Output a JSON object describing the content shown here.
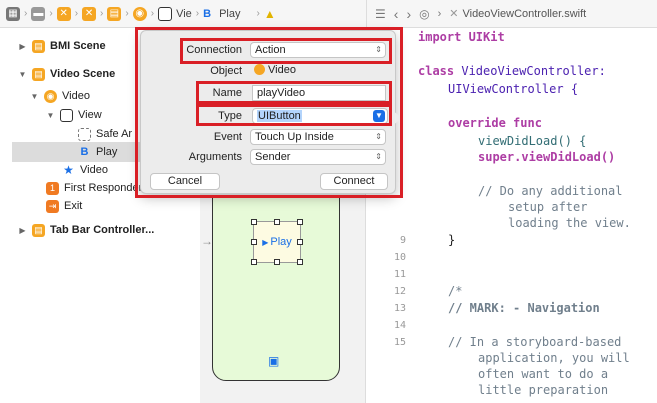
{
  "breadcrumb": {
    "view": "Vie",
    "play": "Play"
  },
  "editor": {
    "filename": "VideoViewController.swift"
  },
  "outline": {
    "bmi_scene": "BMI Scene",
    "video_scene": "Video Scene",
    "video_controller": "Video",
    "view": "View",
    "safe_area": "Safe Ar",
    "play": "Play",
    "video_item": "Video",
    "first_responder": "First Responder",
    "exit": "Exit",
    "tab_bar": "Tab Bar Controller..."
  },
  "canvas": {
    "play_button": "Play"
  },
  "dialog": {
    "connection_label": "Connection",
    "connection_value": "Action",
    "object_label": "Object",
    "object_value": "Video",
    "name_label": "Name",
    "name_value": "playVideo",
    "type_label": "Type",
    "type_value": "UIButton",
    "event_label": "Event",
    "event_value": "Touch Up Inside",
    "arguments_label": "Arguments",
    "arguments_value": "Sender",
    "cancel": "Cancel",
    "connect": "Connect"
  },
  "code": {
    "l_import": "import UIKit",
    "l_class1": "class VideoViewController:",
    "l_class2": "UIViewController {",
    "l_override": "override func",
    "l_viewdidload": "viewDidLoad() {",
    "l_super": "super.viewDidLoad()",
    "l_c1": "// Do any additional",
    "l_c2": "setup after",
    "l_c3": "loading the view.",
    "l_close": "}",
    "l_open_comment": "/*",
    "l_mark": "// MARK: - Navigation",
    "l_n1": "// In a storyboard-based",
    "l_n2": "application, you will",
    "l_n3": "often want to do a",
    "l_n4": "little preparation"
  },
  "line_numbers": [
    "9",
    "10",
    "11",
    "12",
    "13",
    "14",
    "15"
  ]
}
